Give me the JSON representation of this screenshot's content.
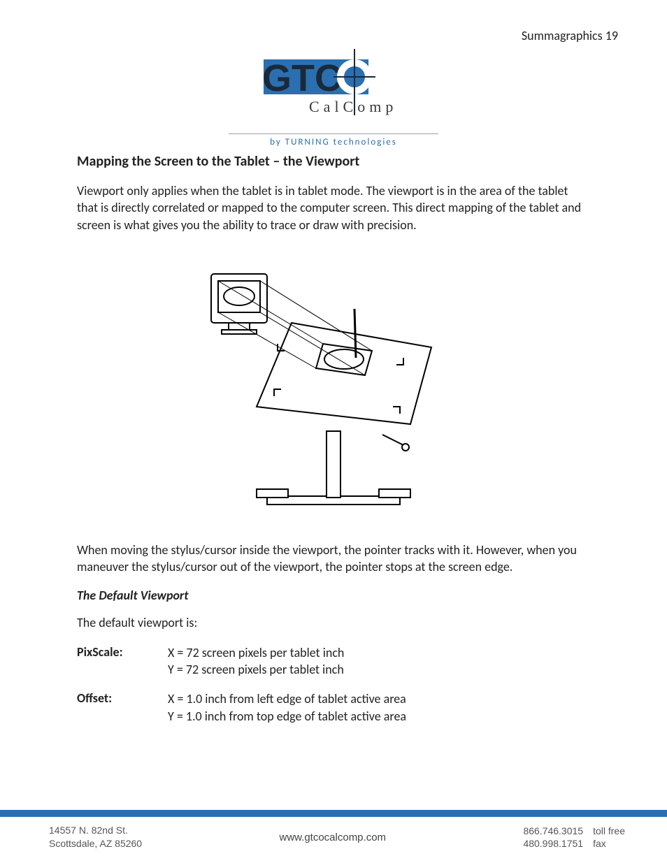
{
  "header": {
    "page_label": "Summagraphics 19"
  },
  "logo": {
    "main": "GTCO",
    "sub": "C a l C o m p",
    "byline": "by  TURNING  technologies"
  },
  "section_title": "Mapping the Screen to the Tablet – the Viewport",
  "para1": "Viewport only applies when the tablet is in tablet mode.  The viewport is in the area of the tablet that is directly correlated or mapped to the computer screen.  This direct mapping of the tablet and screen is what gives you the ability to trace or draw with precision.",
  "para2": "When moving the stylus/cursor inside the viewport, the pointer tracks with it.  However, when you maneuver the stylus/cursor out of the viewport, the pointer stops at the screen edge.",
  "subhead": "The Default Viewport",
  "para3": "The default viewport is:",
  "defs": {
    "pixscale": {
      "label": "PixScale:",
      "x": "X = 72 screen pixels per tablet inch",
      "y": "Y = 72 screen pixels per tablet inch"
    },
    "offset": {
      "label": "Offset:",
      "x": "X = 1.0 inch from left edge of tablet active area",
      "y": "Y = 1.0 inch from top edge of tablet active area"
    }
  },
  "footer": {
    "addr1": "14557 N. 82nd St.",
    "addr2": "Scottsdale, AZ 85260",
    "url": "www.gtcocalcomp.com",
    "phone1": "866.746.3015",
    "phone1_label": "toll free",
    "phone2": "480.998.1751",
    "phone2_label": "fax"
  }
}
